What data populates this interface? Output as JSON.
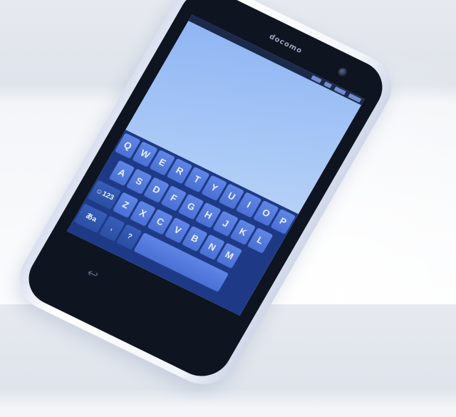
{
  "scene": {
    "description_brand": "docomo",
    "background_color": "#eef1f5",
    "accent_screen": "#a9c9f6",
    "keyboard_color": "#1e3a86"
  },
  "keyboard": {
    "row1": [
      "Q",
      "W",
      "E",
      "R",
      "T",
      "Y",
      "U",
      "I",
      "O",
      "P"
    ],
    "row2": [
      "A",
      "S",
      "D",
      "F",
      "G",
      "H",
      "J",
      "K",
      "L"
    ],
    "row3": [
      "Z",
      "X",
      "C",
      "V",
      "B",
      "N",
      "M"
    ],
    "row4_left": "あa",
    "emoji_key": "☺123",
    "punct": ",",
    "question": "?",
    "back_icon": "↩"
  }
}
